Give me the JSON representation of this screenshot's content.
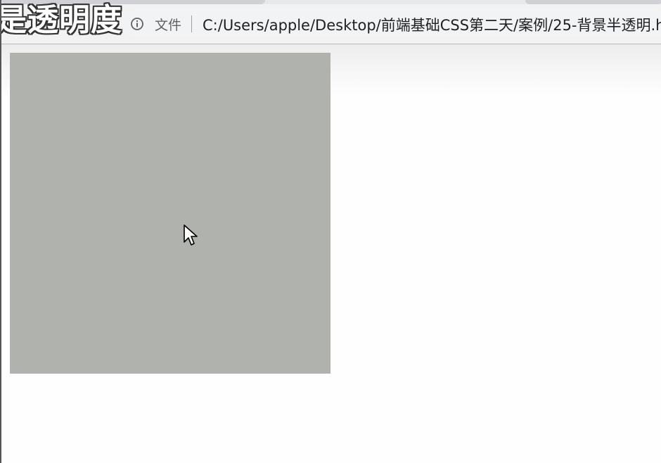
{
  "browser": {
    "security_label": "文件",
    "address_url": "C:/Users/apple/Desktop/前端基础CSS第二天/案例/25-背景半透明.h",
    "info_icon": "info-icon",
    "nav_glyphs": "‹ ›"
  },
  "caption": {
    "text": "是透明度"
  },
  "page": {
    "box_color": "#b0b2ae",
    "background_color": "#fdfefd"
  },
  "cursor": {
    "icon": "pointer-arrow-icon"
  }
}
